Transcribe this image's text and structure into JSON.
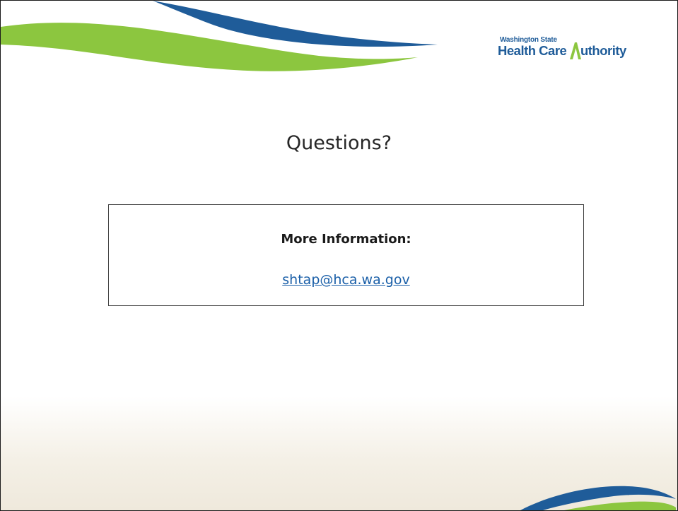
{
  "logo": {
    "line1": "Washington State",
    "line2_part1": "Health Care ",
    "line2_part2": "uthority"
  },
  "slide": {
    "title": "Questions?"
  },
  "info_box": {
    "heading": "More Information:",
    "email": "shtap@hca.wa.gov"
  },
  "colors": {
    "swoosh_blue": "#1f5c99",
    "swoosh_green": "#8cc63f",
    "link": "#1a5fa8"
  }
}
